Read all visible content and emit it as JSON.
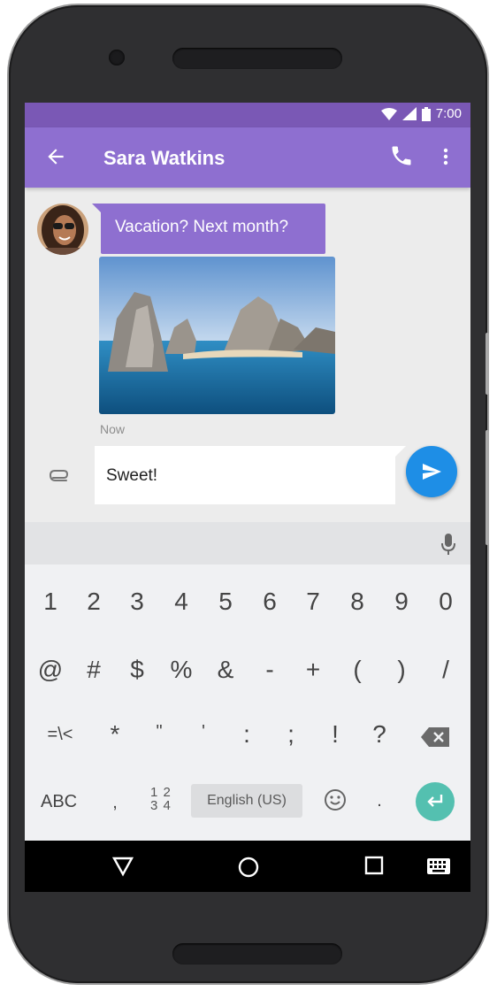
{
  "status_bar": {
    "time": "7:00"
  },
  "app_bar": {
    "title": "Sara Watkins"
  },
  "conversation": {
    "incoming_message": "Vacation? Next month?",
    "timestamp": "Now"
  },
  "composer": {
    "text": "Sweet!"
  },
  "keyboard": {
    "row1": [
      "1",
      "2",
      "3",
      "4",
      "5",
      "6",
      "7",
      "8",
      "9",
      "0"
    ],
    "row2": [
      "@",
      "#",
      "$",
      "%",
      "&",
      "-",
      "+",
      "(",
      ")",
      "/"
    ],
    "row3": [
      "=\\<",
      "*",
      "\"",
      "'",
      ":",
      ";",
      "!",
      "?"
    ],
    "abc_label": "ABC",
    "comma": ",",
    "num_toggle_top": "1 2",
    "num_toggle_bottom": "3 4",
    "language_label": "English (US)",
    "period": "."
  },
  "colors": {
    "app_bar": "#8e6fd0",
    "status_bar": "#7a58b5",
    "send_button": "#1e8ee6",
    "enter_key": "#54c0b0"
  },
  "icons": [
    "back-arrow-icon",
    "phone-icon",
    "more-vert-icon",
    "paperclip-icon",
    "send-icon",
    "mic-icon",
    "backspace-icon",
    "emoji-icon",
    "enter-icon",
    "nav-back-icon",
    "nav-home-icon",
    "nav-recents-icon",
    "keyboard-icon"
  ]
}
